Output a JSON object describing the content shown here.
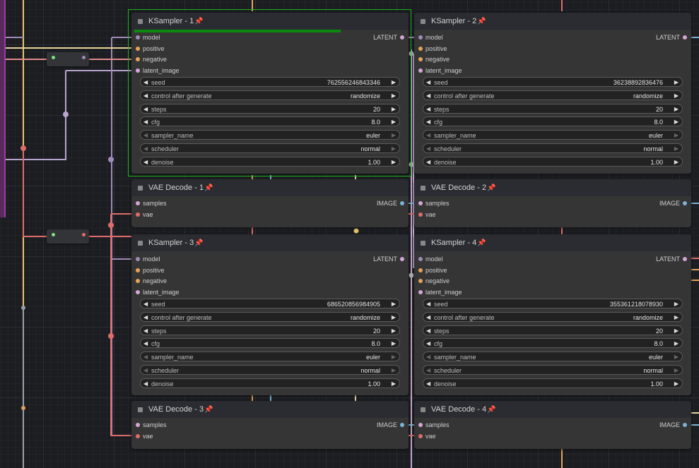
{
  "colors": {
    "model": "#a18ab8",
    "positive": "#e6a35a",
    "negative": "#e6a35a",
    "latent": "#d4a6d8",
    "image": "#7ab4d4",
    "vae": "#e06b6b",
    "selected": "#1db31d"
  },
  "ksampler_nodes": [
    {
      "title": "KSampler - 1",
      "pin": "📌",
      "inputs": [
        "model",
        "positive",
        "negative",
        "latent_image"
      ],
      "output": "LATENT",
      "progress": 0.76,
      "selected": true,
      "widgets": [
        {
          "label": "seed",
          "value": "762556246843346"
        },
        {
          "label": "control after generate",
          "value": "randomize"
        },
        {
          "label": "steps",
          "value": "20"
        },
        {
          "label": "cfg",
          "value": "8.0"
        },
        {
          "label": "sampler_name",
          "value": "euler"
        },
        {
          "label": "scheduler",
          "value": "normal"
        },
        {
          "label": "denoise",
          "value": "1.00"
        }
      ]
    },
    {
      "title": "KSampler - 2",
      "pin": "📌",
      "inputs": [
        "model",
        "positive",
        "negative",
        "latent_image"
      ],
      "output": "LATENT",
      "progress": 0,
      "selected": false,
      "widgets": [
        {
          "label": "seed",
          "value": "36238892836476"
        },
        {
          "label": "control after generate",
          "value": "randomize"
        },
        {
          "label": "steps",
          "value": "20"
        },
        {
          "label": "cfg",
          "value": "8.0"
        },
        {
          "label": "sampler_name",
          "value": "euler"
        },
        {
          "label": "scheduler",
          "value": "normal"
        },
        {
          "label": "denoise",
          "value": "1.00"
        }
      ]
    },
    {
      "title": "KSampler - 3",
      "pin": "📌",
      "inputs": [
        "model",
        "positive",
        "negative",
        "latent_image"
      ],
      "output": "LATENT",
      "progress": 0,
      "selected": false,
      "widgets": [
        {
          "label": "seed",
          "value": "686520856984905"
        },
        {
          "label": "control after generate",
          "value": "randomize"
        },
        {
          "label": "steps",
          "value": "20"
        },
        {
          "label": "cfg",
          "value": "8.0"
        },
        {
          "label": "sampler_name",
          "value": "euler"
        },
        {
          "label": "scheduler",
          "value": "normal"
        },
        {
          "label": "denoise",
          "value": "1.00"
        }
      ]
    },
    {
      "title": "KSampler - 4",
      "pin": "📌",
      "inputs": [
        "model",
        "positive",
        "negative",
        "latent_image"
      ],
      "output": "LATENT",
      "progress": 0,
      "selected": false,
      "widgets": [
        {
          "label": "seed",
          "value": "355361218078930"
        },
        {
          "label": "control after generate",
          "value": "randomize"
        },
        {
          "label": "steps",
          "value": "20"
        },
        {
          "label": "cfg",
          "value": "8.0"
        },
        {
          "label": "sampler_name",
          "value": "euler"
        },
        {
          "label": "scheduler",
          "value": "normal"
        },
        {
          "label": "denoise",
          "value": "1.00"
        }
      ]
    }
  ],
  "vae_nodes": [
    {
      "title": "VAE Decode - 1",
      "pin": "📌",
      "inputs": [
        "samples",
        "vae"
      ],
      "output": "IMAGE"
    },
    {
      "title": "VAE Decode - 2",
      "pin": "📌",
      "inputs": [
        "samples",
        "vae"
      ],
      "output": "IMAGE"
    },
    {
      "title": "VAE Decode - 3",
      "pin": "📌",
      "inputs": [
        "samples",
        "vae"
      ],
      "output": "IMAGE"
    },
    {
      "title": "VAE Decode - 4",
      "pin": "📌",
      "inputs": [
        "samples",
        "vae"
      ],
      "output": "IMAGE"
    }
  ]
}
